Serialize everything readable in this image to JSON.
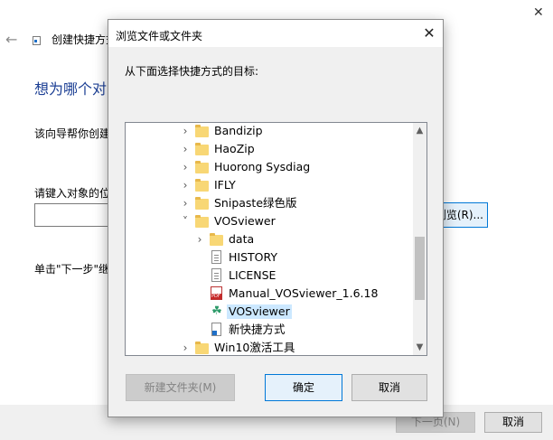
{
  "wizard": {
    "title": "创建快捷方式",
    "heading": "想为哪个对象创建快捷方式？",
    "description": "该向导帮你创建",
    "prompt": "请键入对象的位置(T):",
    "browse_label": "浏览(R)...",
    "hint": "单击\"下一步\"继续。",
    "next_label": "下一页(N)",
    "cancel_label": "取消"
  },
  "dialog": {
    "title": "浏览文件或文件夹",
    "instruction": "从下面选择快捷方式的目标:",
    "tree": [
      {
        "label": "Bandizip",
        "icon": "folder-icon",
        "expander": "collapsed",
        "level": 1
      },
      {
        "label": "HaoZip",
        "icon": "folder-icon",
        "expander": "collapsed",
        "level": 1
      },
      {
        "label": "Huorong Sysdiag",
        "icon": "folder-icon",
        "expander": "collapsed",
        "level": 1
      },
      {
        "label": "IFLY",
        "icon": "folder-icon",
        "expander": "collapsed",
        "level": 1
      },
      {
        "label": "Snipaste绿色版",
        "icon": "folder-icon",
        "expander": "collapsed",
        "level": 1
      },
      {
        "label": "VOSviewer",
        "icon": "folder-icon",
        "expander": "expanded",
        "level": 1
      },
      {
        "label": "data",
        "icon": "folder-icon",
        "expander": "collapsed",
        "level": 2
      },
      {
        "label": "HISTORY",
        "icon": "document-icon",
        "expander": "none",
        "level": 2
      },
      {
        "label": "LICENSE",
        "icon": "document-icon",
        "expander": "none",
        "level": 2
      },
      {
        "label": "Manual_VOSviewer_1.6.18",
        "icon": "pdf-icon",
        "expander": "none",
        "level": 2
      },
      {
        "label": "VOSviewer",
        "icon": "vosviewer-app-icon",
        "expander": "none",
        "level": 2,
        "selected": true
      },
      {
        "label": "新快捷方式",
        "icon": "shortcut-icon",
        "expander": "none",
        "level": 2
      },
      {
        "label": "Win10激活工具",
        "icon": "folder-icon",
        "expander": "collapsed",
        "level": 1
      }
    ],
    "new_folder_label": "新建文件夹(M)",
    "ok_label": "确定",
    "cancel_label": "取消"
  }
}
